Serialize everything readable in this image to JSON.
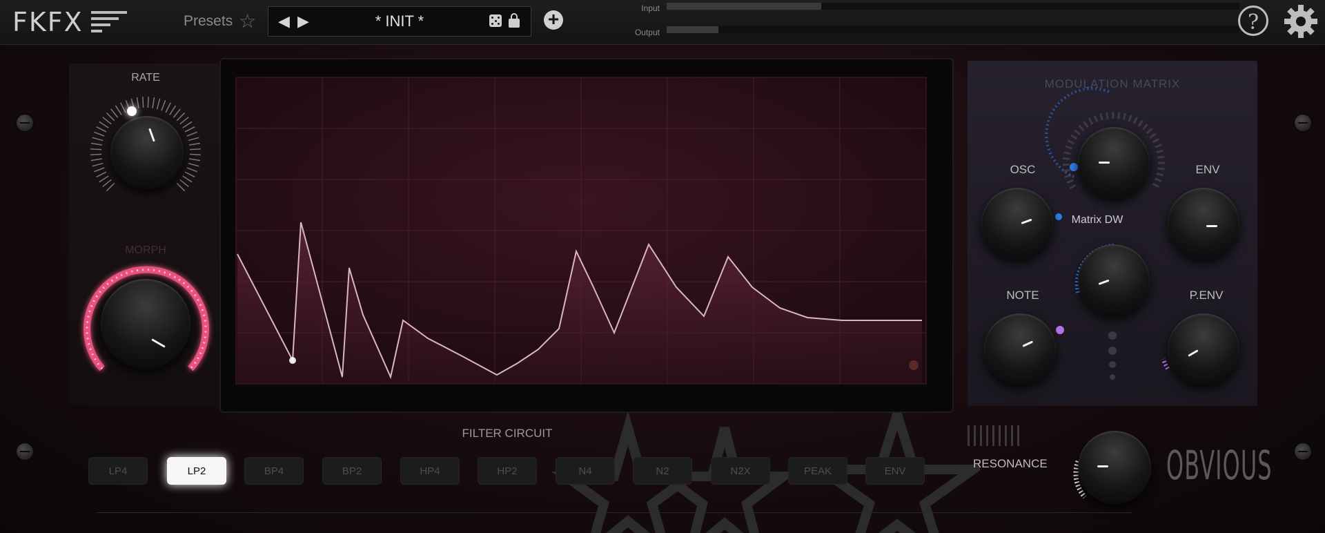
{
  "app": {
    "logo": "FKFX"
  },
  "header": {
    "presets_label": "Presets",
    "preset_name": "* INIT *",
    "prev_icon": "◀",
    "next_icon": "▶",
    "add_icon": "+",
    "help_icon": "?",
    "meters": [
      {
        "label": "Input",
        "level": 0.27
      },
      {
        "label": "Output",
        "level": 0.09
      }
    ]
  },
  "left_panel": {
    "rate_label": "RATE",
    "morph_label": "MORPH"
  },
  "matrix": {
    "title": "MODULATION MATRIX",
    "osc_label": "OSC",
    "env_label": "ENV",
    "note_label": "NOTE",
    "penv_label": "P.ENV",
    "drywet_label": "Matrix DW"
  },
  "filter": {
    "title": "FILTER CIRCUIT",
    "buttons": [
      "LP4",
      "LP2",
      "BP4",
      "BP2",
      "HP4",
      "HP2",
      "N4",
      "N2",
      "N2X",
      "PEAK",
      "ENV"
    ],
    "active": "LP2",
    "resonance_label": "RESONANCE"
  },
  "brand": "OBVIOUS",
  "colors": {
    "morph_ring": "#ff5a8a",
    "mod_blue": "#2f8cff",
    "mod_purple": "#c77dff",
    "display_bg": "#2a0f16"
  }
}
